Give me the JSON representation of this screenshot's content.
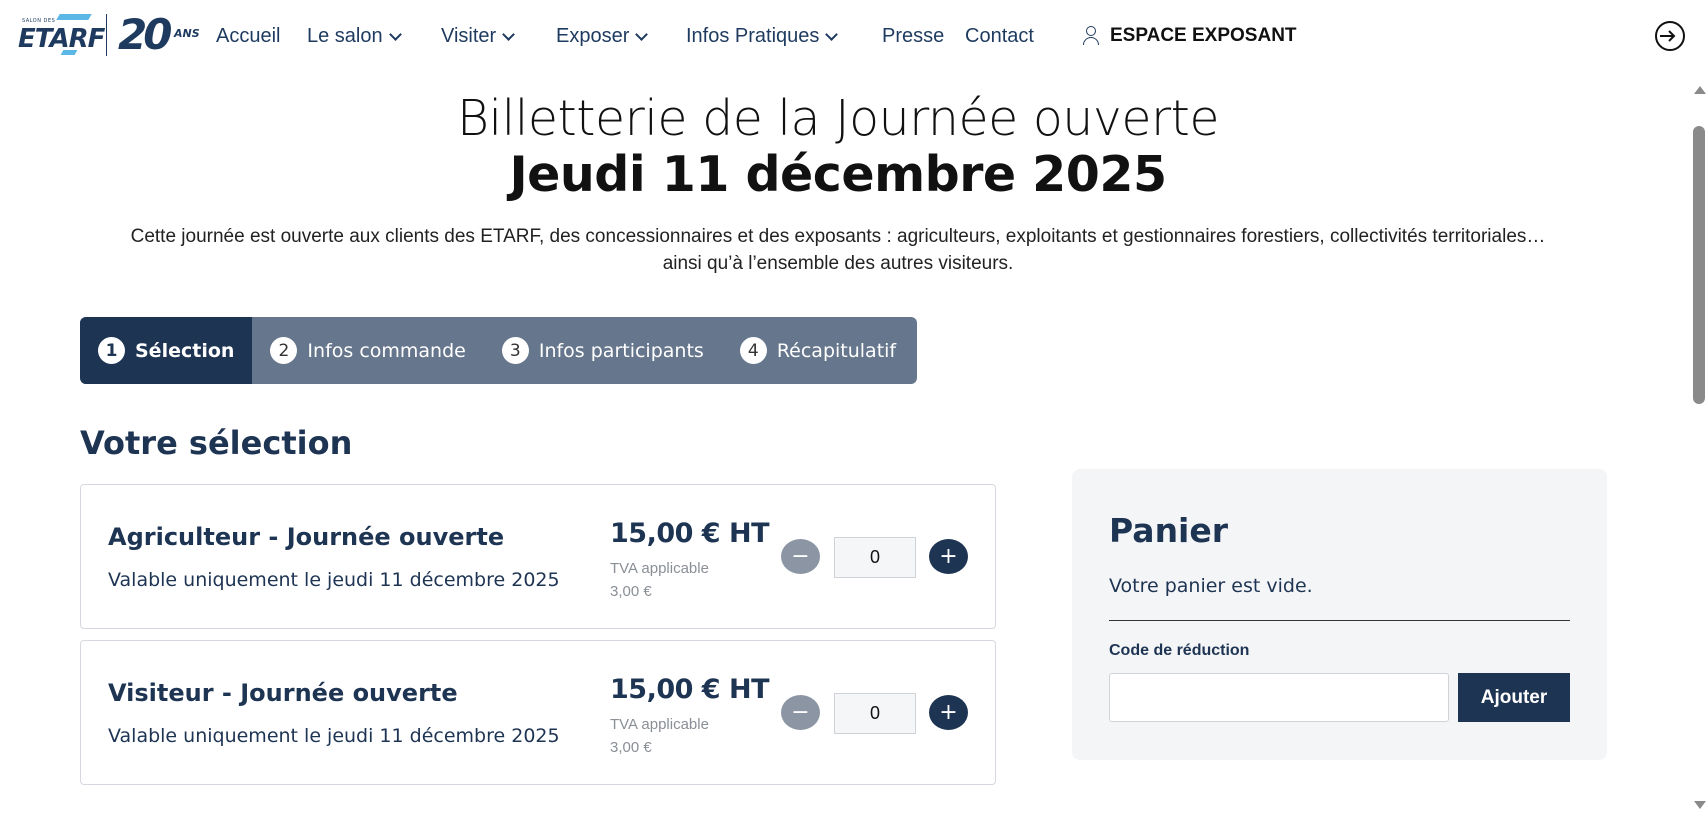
{
  "header": {
    "logo": {
      "small_text": "SALON DES",
      "brand": "ETARF",
      "anniversary_number": "20",
      "anniversary_suffix": "ANS"
    },
    "nav": [
      {
        "label": "Accueil",
        "dropdown": false
      },
      {
        "label": "Le salon",
        "dropdown": true
      },
      {
        "label": "Visiter",
        "dropdown": true
      },
      {
        "label": "Exposer",
        "dropdown": true
      },
      {
        "label": "Infos Pratiques",
        "dropdown": true
      },
      {
        "label": "Presse",
        "dropdown": false
      },
      {
        "label": "Contact",
        "dropdown": false
      }
    ],
    "account_label": "ESPACE EXPOSANT",
    "account_icon": "user-icon",
    "logout_icon": "logout-icon"
  },
  "page": {
    "title_line1": "Billetterie de la Journée ouverte",
    "title_line2": "Jeudi 11 décembre 2025",
    "intro": "Cette journée est ouverte aux clients des ETARF, des concessionnaires et des exposants : agriculteurs, exploitants et gestionnaires forestiers, collectivités territoriales… ainsi qu’à l’ensemble des autres visiteurs."
  },
  "stepper": [
    {
      "number": "1",
      "label": "Sélection",
      "active": true
    },
    {
      "number": "2",
      "label": "Infos commande",
      "active": false
    },
    {
      "number": "3",
      "label": "Infos participants",
      "active": false
    },
    {
      "number": "4",
      "label": "Récapitulatif",
      "active": false
    }
  ],
  "selection": {
    "title": "Votre sélection",
    "products": [
      {
        "name": "Agriculteur - Journée ouverte",
        "description": "Valable uniquement le jeudi 11 décembre 2025",
        "price": "15,00 € HT",
        "tva_label": "TVA applicable",
        "tva_value": "3,00 €",
        "quantity": "0",
        "minus_symbol": "−",
        "plus_symbol": "+"
      },
      {
        "name": "Visiteur - Journée ouverte",
        "description": "Valable uniquement le jeudi 11 décembre 2025",
        "price": "15,00 € HT",
        "tva_label": "TVA applicable",
        "tva_value": "3,00 €",
        "quantity": "0",
        "minus_symbol": "−",
        "plus_symbol": "+"
      }
    ]
  },
  "cart": {
    "title": "Panier",
    "empty_message": "Votre panier est vide.",
    "discount_label": "Code de réduction",
    "discount_value": "",
    "add_button": "Ajouter"
  },
  "colors": {
    "primary": "#1e3453",
    "stepper_bg": "#66768c",
    "minus_button": "#8b95a3",
    "cart_bg": "#f4f5f7"
  }
}
